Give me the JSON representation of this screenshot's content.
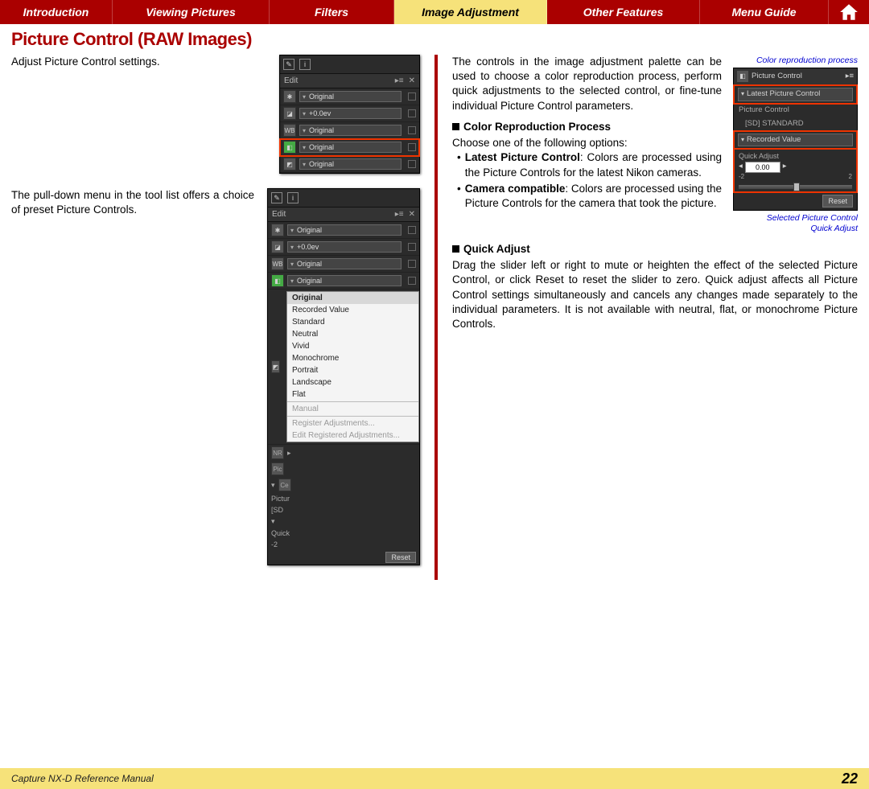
{
  "nav": {
    "intro": "Introduction",
    "viewing": "Viewing Pictures",
    "filters": "Filters",
    "imageadj": "Image Adjustment",
    "other": "Other Features",
    "menu": "Menu Guide"
  },
  "section_title": "Picture Control (RAW Images)",
  "left": {
    "p1": "Adjust Picture Control settings.",
    "p2": "The pull-down menu in the tool list offers a choice of preset Picture Controls.",
    "panel": {
      "edit": "Edit",
      "rows": {
        "r0": "Original",
        "r1": "+0.0ev",
        "r2": "Original",
        "r3": "Original",
        "r4": "Original"
      },
      "popup_top": "Original",
      "popup": {
        "i0": "Recorded Value",
        "i1": "Standard",
        "i2": "Neutral",
        "i3": "Vivid",
        "i4": "Monochrome",
        "i5": "Portrait",
        "i6": "Landscape",
        "i7": "Flat",
        "i8": "Manual",
        "i9": "Register Adjustments...",
        "i10": "Edit Registered Adjustments..."
      },
      "below": {
        "pc": "Pictur",
        "sd": "[SD",
        "qa": "Quick",
        "neg2": "-2"
      },
      "reset": "Reset",
      "icons": {
        "nr": "NR",
        "pic": "Pic",
        "ce": "Ce"
      }
    }
  },
  "right": {
    "p1": "The controls in the image adjustment palette can be used to choose a color reproduction process, perform quick adjustments to the selected control, or fine-tune individual Picture Control parameters.",
    "crp_label": "Color reproduction process",
    "sel_label_1": "Selected Picture Control",
    "sel_label_2": "Quick Adjust",
    "h1": "Color Reproduction Process",
    "h1_sub": "Choose one of the following options:",
    "b1_bold": "Latest Picture Control",
    "b1_rest": ": Colors are processed using the Picture Controls for the latest Nikon cameras.",
    "b2_bold": "Camera compatible",
    "b2_rest": ": Colors are processed using the Picture Controls for the camera that took the picture.",
    "h2": "Quick Adjust",
    "h2_body": "Drag the slider left or right to mute or heighten the effect of the selected Picture Control, or click Reset to reset the slider to zero. Quick adjust affects all Picture Control settings simultaneously and cancels any changes made separately to the individual parameters. It is not available with neutral, flat, or monochrome Picture Controls.",
    "pc_panel": {
      "title": "Picture Control",
      "latest": "Latest Picture Control",
      "sub1": "Picture Control",
      "sub2": "[SD] STANDARD",
      "recorded": "Recorded Value",
      "qa_label": "Quick Adjust",
      "qa_val": "0.00",
      "neg2": "-2",
      "pos2": "2",
      "reset": "Reset"
    }
  },
  "footer": {
    "title": "Capture NX-D Reference Manual",
    "page": "22"
  }
}
